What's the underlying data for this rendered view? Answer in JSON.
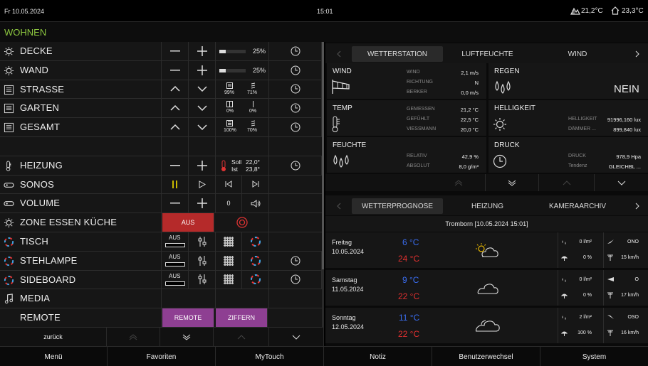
{
  "topbar": {
    "date": "Fr  10.05.2024",
    "time": "15:01",
    "outdoor_temp": "21,2°C",
    "indoor_temp": "23,3°C"
  },
  "room": {
    "title": "WOHNEN"
  },
  "rows": [
    {
      "label": "DECKE",
      "level": "25%",
      "level_fraction": 0.25
    },
    {
      "label": "WAND",
      "level": "25%",
      "level_fraction": 0.25
    },
    {
      "label": "STRASSE",
      "pos": "99%",
      "tilt": "71%"
    },
    {
      "label": "GARTEN",
      "pos": "0%",
      "tilt": "0%"
    },
    {
      "label": "GESAMT",
      "pos": "100%",
      "tilt": "70%"
    },
    {
      "label": "HEIZUNG",
      "soll_label": "Soll",
      "soll": "22,0°",
      "ist_label": "Ist",
      "ist": "23,8°"
    },
    {
      "label": "SONOS"
    },
    {
      "label": "VOLUME",
      "value": "0"
    },
    {
      "label": "ZONE ESSEN KÜCHE",
      "button": "AUS"
    },
    {
      "label": "TISCH",
      "state": "AUS"
    },
    {
      "label": "STEHLAMPE",
      "state": "AUS"
    },
    {
      "label": "SIDEBOARD",
      "state": "AUS"
    },
    {
      "label": "MEDIA"
    },
    {
      "label": "REMOTE",
      "btn1": "REMOTE",
      "btn2": "ZIFFERN"
    }
  ],
  "subnav": {
    "back": "zurück"
  },
  "weather_tabs": [
    "WETTERSTATION",
    "LUFTFEUCHTE",
    "WIND"
  ],
  "weather": {
    "wind": {
      "title": "WIND",
      "k1": "WIND",
      "v1": "2,1 m/s",
      "k2": "RICHTUNG",
      "v2": "N",
      "k3": "BERKER",
      "v3": "0,0 m/s"
    },
    "regen": {
      "title": "REGEN",
      "value": "NEIN"
    },
    "temp": {
      "title": "TEMP",
      "k1": "GEMESSEN",
      "v1": "21,2 °C",
      "k2": "GEFÜHLT",
      "v2": "22,5 °C",
      "k3": "VIESSMANN",
      "v3": "20,0 °C"
    },
    "hell": {
      "title": "HELLIGKEIT",
      "k1": "HELLIGKEIT",
      "v1": "91996,160 lux",
      "k2": "DÄMMER ...",
      "v2": "899,840 lux"
    },
    "feuchte": {
      "title": "FEUCHTE",
      "k1": "RELATIV",
      "v1": "42,9 %",
      "k2": "ABSOLUT",
      "v2": "8,0 g/m³"
    },
    "druck": {
      "title": "DRUCK",
      "k1": "DRUCK",
      "v1": "978,9 Hpa",
      "k2": "Tendenz",
      "v2": "GLEICHBL ..."
    }
  },
  "forecast_tabs": [
    "WETTERPROGNOSE",
    "HEIZUNG",
    "KAMERAARCHIV"
  ],
  "forecast_location": "Tromborn  [10.05.2024 15:01]",
  "forecast": [
    {
      "day": "Freitag",
      "date": "10.05.2024",
      "tmin": "6 °C",
      "tmax": "24 °C",
      "rain": "0 l/m²",
      "rain_prob": "0 %",
      "wind_dir": "ONO",
      "wind_speed": "15 km/h"
    },
    {
      "day": "Samstag",
      "date": "11.05.2024",
      "tmin": "9 °C",
      "tmax": "22 °C",
      "rain": "0 l/m²",
      "rain_prob": "0 %",
      "wind_dir": "O",
      "wind_speed": "17 km/h"
    },
    {
      "day": "Sonntag",
      "date": "12.05.2024",
      "tmin": "11 °C",
      "tmax": "22 °C",
      "rain": "2 l/m²",
      "rain_prob": "100 %",
      "wind_dir": "OSO",
      "wind_speed": "16 km/h"
    }
  ],
  "bottom_nav": [
    "Menü",
    "Favoriten",
    "MyTouch",
    "Notiz",
    "Benutzerwechsel",
    "System"
  ],
  "colors": {
    "accent_green": "#8cc63f",
    "red": "#b52a2a",
    "purple": "#8e3f92",
    "tmin_blue": "#3a6df0",
    "tmax_red": "#e03030"
  }
}
